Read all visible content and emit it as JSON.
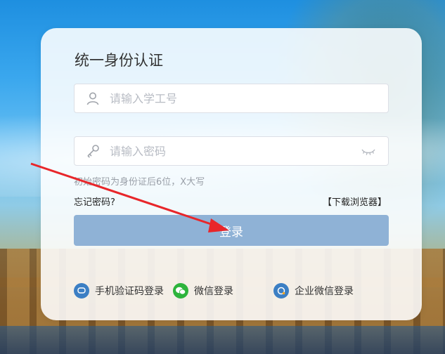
{
  "login": {
    "title": "统一身份认证",
    "username_placeholder": "请输入学工号",
    "password_placeholder": "请输入密码",
    "password_hint": "初始密码为身份证后6位，X大写",
    "forgot_label": "忘记密码?",
    "download_label": "【下载浏览器】",
    "submit_label": "登录"
  },
  "alt_logins": [
    {
      "label": "手机验证码登录",
      "icon": "phone-sms-icon"
    },
    {
      "label": "微信登录",
      "icon": "wechat-icon"
    },
    {
      "label": "企业微信登录",
      "icon": "wework-icon"
    }
  ],
  "colors": {
    "submit_button": "#8fb2d6",
    "annotation_arrow": "#e8262a",
    "wechat": "#2db43c",
    "brand_blue": "#3c7fc4"
  }
}
